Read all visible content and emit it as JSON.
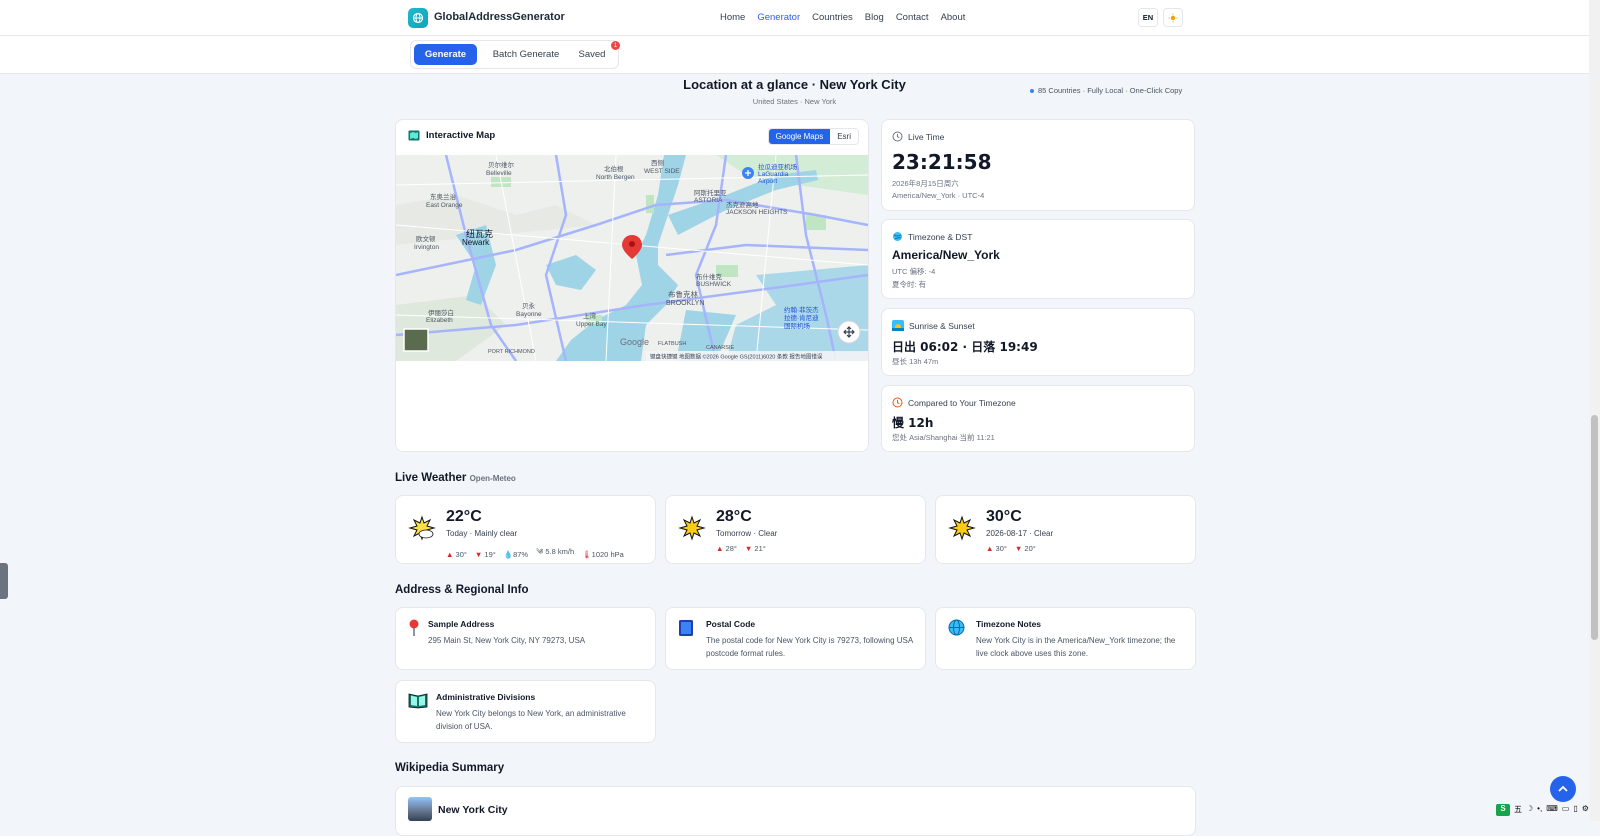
{
  "header": {
    "brand": "GlobalAddressGenerator",
    "nav": [
      "Home",
      "Generator",
      "Countries",
      "Blog",
      "Contact",
      "About"
    ],
    "active_nav": "Generator",
    "lang": "EN"
  },
  "subbar": {
    "tabs": {
      "generate": "Generate",
      "batch": "Batch Generate",
      "saved": "Saved"
    },
    "saved_count": "1",
    "tagline": "85 Countries · Fully Local · One-Click Copy"
  },
  "location": {
    "title": "Location at a glance · New York City",
    "subtitle": "United States · New York"
  },
  "map": {
    "title": "Interactive Map",
    "providers": [
      "Google Maps",
      "Esri"
    ],
    "labels": {
      "belleville": "贝尔维尔\nBelleville",
      "north_bergen": "北伯根\nNorth Bergen",
      "west_side": "西侧\nWEST SIDE",
      "laguardia": "拉瓜迪亚机场\nLaGuardia Airport",
      "astoria": "阿斯托里亚\nASTORIA",
      "jackson": "杰克逊高地\nJACKSON HEIGHTS",
      "east_orange": "东奥兰治\nEast Orange",
      "newark": "纽瓦克\nNewark",
      "irvington": "欧文顿\nIrvington",
      "bushwick": "布什维克\nBUSHWICK",
      "brooklyn": "布鲁克林\nBROOKLYN",
      "bayonne": "贝永\nBayonne",
      "elizabeth": "伊丽莎白\nElizabeth",
      "upper_bay": "上湾\nUpper Bay",
      "jfk": "约翰·菲茨杰拉德·肯尼迪国际机场",
      "port_richmond": "PORT RICHMOND",
      "flatbush": "FLATBUSH",
      "canarsie": "CANARSIE",
      "google": "Google",
      "footer": "键盘快捷键   地图数据 ©2026 Google GS(2011)6020   条款   报告地图错误"
    }
  },
  "live_time": {
    "label": "Live Time",
    "time": "23:21:58",
    "date": "2026年8月15日周六",
    "tz": "America/New_York · UTC-4"
  },
  "timezone": {
    "label": "Timezone & DST",
    "name": "America/New_York",
    "offset": "UTC 偏移: -4",
    "dst": "夏令时: 有"
  },
  "sun": {
    "label": "Sunrise & Sunset",
    "value": "日出 06:02 · 日落 19:49",
    "length": "昼长 13h 47m"
  },
  "compare": {
    "label": "Compared to Your Timezone",
    "value": "慢 12h",
    "note": "您处 Asia/Shanghai 当前 11:21"
  },
  "weather": {
    "title": "Live Weather",
    "source": "Open-Meteo",
    "days": [
      {
        "temp": "22°C",
        "desc": "Today · Mainly clear",
        "hi": "30°",
        "lo": "19°",
        "humidity": "87%",
        "wind": "5.8 km/h",
        "pressure": "1020 hPa"
      },
      {
        "temp": "28°C",
        "desc": "Tomorrow · Clear",
        "hi": "28°",
        "lo": "21°"
      },
      {
        "temp": "30°C",
        "desc": "2026-08-17 · Clear",
        "hi": "30°",
        "lo": "20°"
      }
    ]
  },
  "regional": {
    "title": "Address & Regional Info",
    "cards": [
      {
        "title": "Sample Address",
        "text": "295 Main St, New York City, NY 79273, USA"
      },
      {
        "title": "Postal Code",
        "text": "The postal code for New York City is 79273, following USA postcode format rules."
      },
      {
        "title": "Timezone Notes",
        "text": "New York City is in the America/New_York timezone; the live clock above uses this zone."
      },
      {
        "title": "Administrative Divisions",
        "text": "New York City belongs to New York, an administrative division of USA."
      }
    ]
  },
  "wiki": {
    "title": "Wikipedia Summary",
    "city": "New York City"
  },
  "tray": [
    "五",
    "☽",
    "•,",
    "⌨",
    "▭",
    "▯",
    "⚙"
  ],
  "colors": {
    "accent": "#2563eb",
    "map_water": "#9fd3e6",
    "marker": "#e53935"
  }
}
